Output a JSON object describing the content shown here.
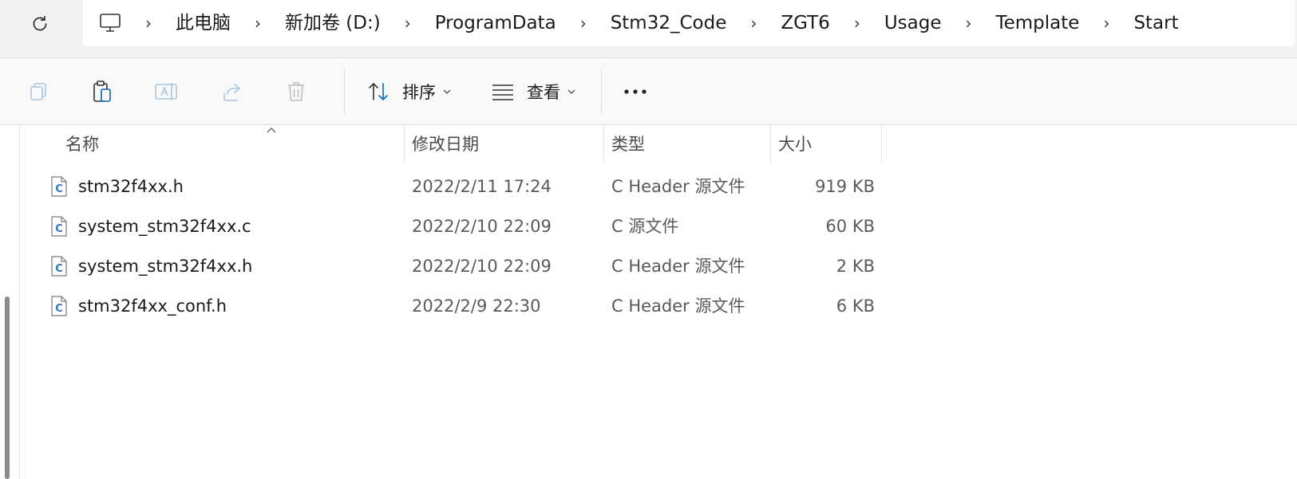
{
  "address_bar": {
    "crumbs": [
      "此电脑",
      "新加卷 (D:)",
      "ProgramData",
      "Stm32_Code",
      "ZGT6",
      "Usage",
      "Template",
      "Start"
    ]
  },
  "toolbar": {
    "sort_label": "排序",
    "view_label": "查看"
  },
  "columns": {
    "name": "名称",
    "date": "修改日期",
    "type": "类型",
    "size": "大小"
  },
  "files": [
    {
      "name": "stm32f4xx.h",
      "date": "2022/2/11 17:24",
      "type": "C Header 源文件",
      "size": "919 KB"
    },
    {
      "name": "system_stm32f4xx.c",
      "date": "2022/2/10 22:09",
      "type": "C 源文件",
      "size": "60 KB"
    },
    {
      "name": "system_stm32f4xx.h",
      "date": "2022/2/10 22:09",
      "type": "C Header 源文件",
      "size": "2 KB"
    },
    {
      "name": "stm32f4xx_conf.h",
      "date": "2022/2/9 22:30",
      "type": "C Header 源文件",
      "size": "6 KB"
    }
  ],
  "icons": {
    "refresh": "refresh-icon",
    "pc": "computer-icon",
    "copy": "copy-icon",
    "paste": "paste-icon",
    "rename": "rename-icon",
    "share": "share-icon",
    "delete": "delete-icon",
    "sort": "sort-icon",
    "view": "view-icon",
    "more": "more-icon",
    "file": "c-file-icon"
  },
  "colors": {
    "accent": "#0067c0",
    "file_icon_blue": "#2b78c5"
  }
}
